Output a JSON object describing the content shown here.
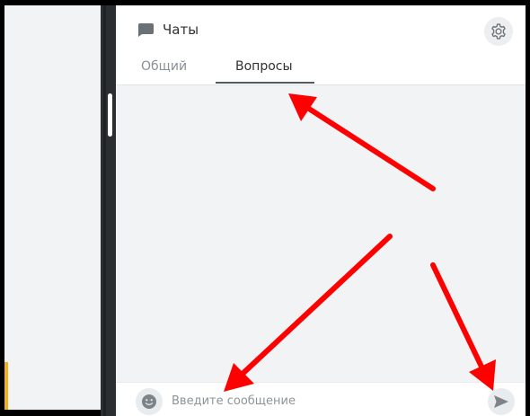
{
  "header": {
    "title": "Чаты",
    "chat_icon": "chat-bubble-icon",
    "settings_icon": "gear-icon"
  },
  "tabs": [
    {
      "label": "Общий",
      "active": false
    },
    {
      "label": "Вопросы",
      "active": true
    }
  ],
  "composer": {
    "placeholder": "Введите сообщение",
    "value": "",
    "emoji_icon": "smiley-icon",
    "send_icon": "send-icon"
  },
  "colors": {
    "annotation_arrow": "#ff0000",
    "panel_background": "#f1f3f4",
    "divider": "#2b2e30",
    "left_accent": "#f3b21a"
  }
}
